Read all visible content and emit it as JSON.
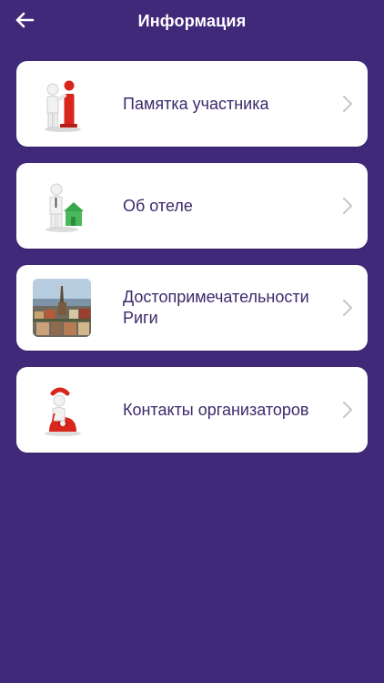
{
  "header": {
    "title": "Информация",
    "back_icon": "arrow-left-icon"
  },
  "items": [
    {
      "label": "Памятка участника",
      "icon": "info-figure-icon"
    },
    {
      "label": "Об отеле",
      "icon": "hotel-figure-icon"
    },
    {
      "label": "Достопримечательности Риги",
      "icon": "riga-photo"
    },
    {
      "label": "Контакты организаторов",
      "icon": "phone-figure-icon"
    }
  ],
  "colors": {
    "background": "#41297a",
    "card": "#ffffff",
    "label": "#3c2a6c",
    "chevron": "#c5c5cc"
  }
}
